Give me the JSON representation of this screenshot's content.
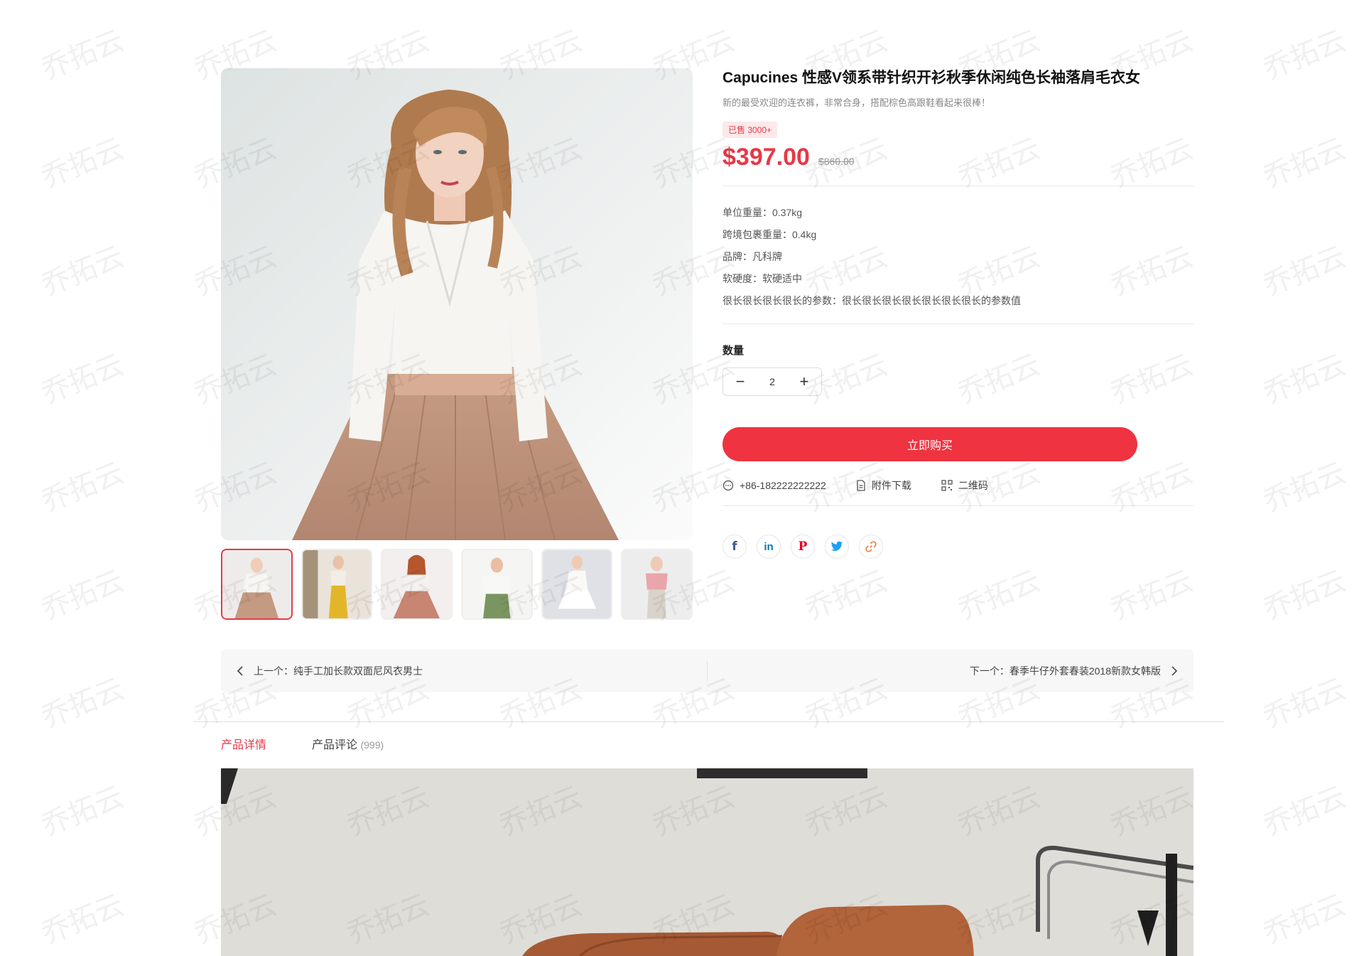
{
  "product": {
    "title": "Capucines 性感V领系带针织开衫秋季休闲纯色长袖落肩毛衣女",
    "subtitle": "新的最受欢迎的连衣裤，非常合身，搭配棕色高跟鞋看起来很棒！",
    "sold_badge": "已售 3000+",
    "price": "$397.00",
    "original_price": "$860.00",
    "accent_color": "#ef3340"
  },
  "specs": [
    {
      "text": "单位重量：0.37kg"
    },
    {
      "text": "跨境包裹重量：0.4kg"
    },
    {
      "text": "品牌：凡科牌"
    },
    {
      "text": "软硬度：软硬适中"
    },
    {
      "text": "很长很长很长很长的参数：很长很长很长很长很长很长很长的参数值"
    }
  ],
  "quantity": {
    "label": "数量",
    "value": "2",
    "minus": "−",
    "plus": "+"
  },
  "actions": {
    "buy_label": "立即购买",
    "phone": "+86-182222222222",
    "attachment": "附件下载",
    "qrcode": "二维码"
  },
  "social": [
    {
      "name": "facebook-icon",
      "glyph": "f",
      "color": "#3b5998"
    },
    {
      "name": "linkedin-icon",
      "glyph": "in",
      "color": "#0077b5"
    },
    {
      "name": "pinterest-icon",
      "glyph": "P",
      "color": "#e60023"
    },
    {
      "name": "twitter-icon",
      "glyph": "t",
      "color": "#1da1f2"
    },
    {
      "name": "link-icon",
      "glyph": "∞",
      "color": "#f07a3a"
    }
  ],
  "navigation": {
    "prev": "上一个：纯手工加长款双面尼风衣男士",
    "next": "下一个：春季牛仔外套春装2018新款女韩版"
  },
  "tabs": {
    "details": "产品详情",
    "reviews": "产品评论",
    "review_count": "(999)"
  },
  "watermark": "乔拓云"
}
